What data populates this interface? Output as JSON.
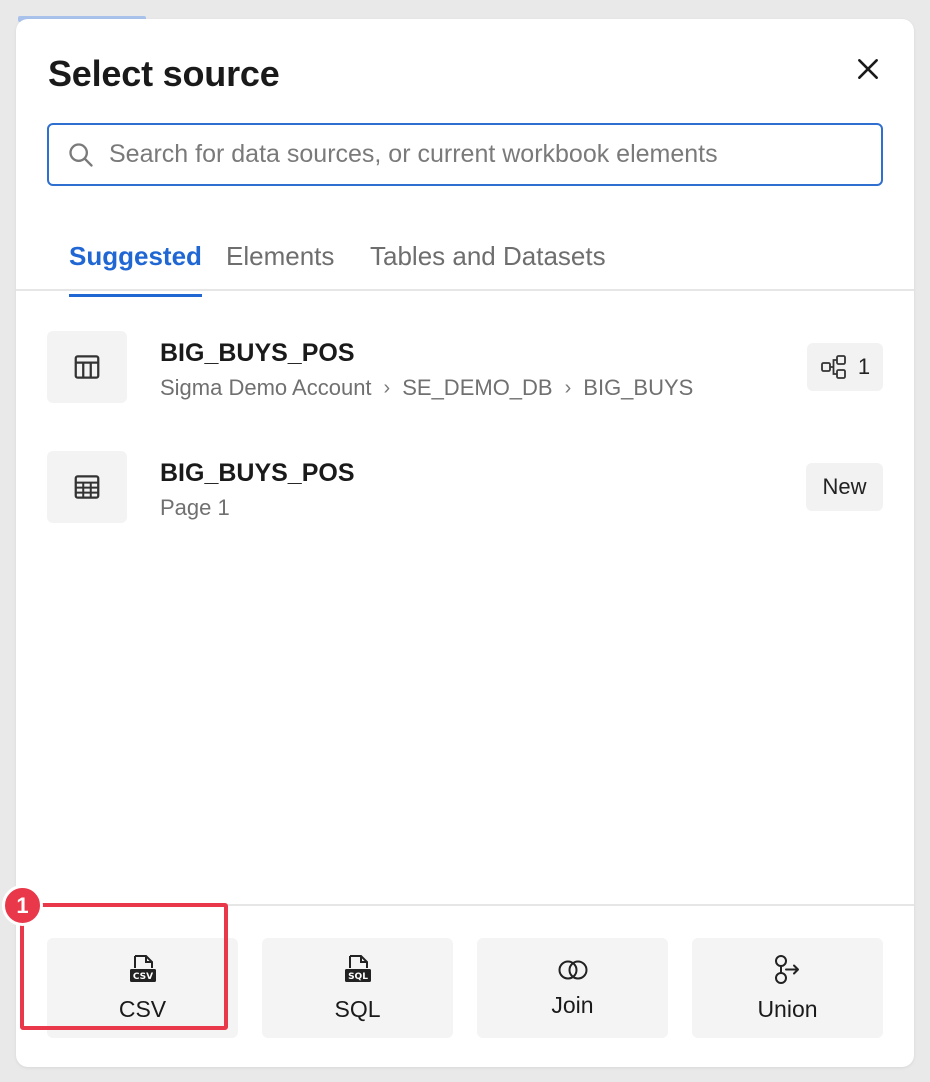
{
  "dialog": {
    "title": "Select source",
    "close_icon": "close-icon"
  },
  "search": {
    "placeholder": "Search for data sources, or current workbook elements",
    "value": "",
    "icon": "search-icon"
  },
  "tabs": [
    {
      "label": "Suggested",
      "active": true
    },
    {
      "label": "Elements",
      "active": false
    },
    {
      "label": "Tables and Datasets",
      "active": false
    }
  ],
  "sources": [
    {
      "icon": "table-icon",
      "title": "BIG_BUYS_POS",
      "path": [
        "Sigma Demo Account",
        "SE_DEMO_DB",
        "BIG_BUYS"
      ],
      "badge_icon": "lineage-icon",
      "badge": "1"
    },
    {
      "icon": "grid-table-icon",
      "title": "BIG_BUYS_POS",
      "subtitle": "Page 1",
      "badge": "New"
    }
  ],
  "actions": [
    {
      "label": "CSV",
      "icon": "csv-file-icon"
    },
    {
      "label": "SQL",
      "icon": "sql-file-icon"
    },
    {
      "label": "Join",
      "icon": "join-icon"
    },
    {
      "label": "Union",
      "icon": "union-icon"
    }
  ],
  "annotation": {
    "step": "1",
    "color": "#e8384a"
  },
  "colors": {
    "accent": "#2067d4",
    "search_border": "#2f6fd0"
  }
}
